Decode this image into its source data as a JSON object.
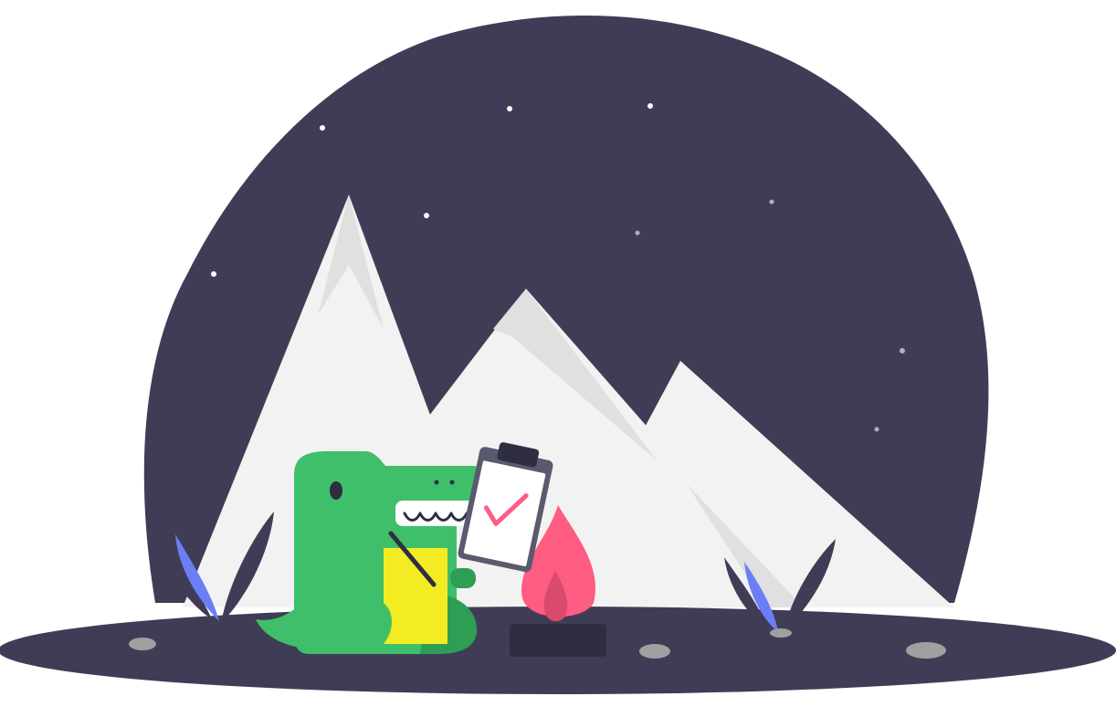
{
  "illustration": {
    "palette": {
      "background": "#ffffff",
      "night_sky": "#3f3d56",
      "ground": "#3f3d56",
      "snow": "#f2f2f2",
      "snow_shadow": "#e0e0e0",
      "star": "#ffffff",
      "dino_body": "#3fbf6a",
      "dino_dark": "#2e9e54",
      "dino_belly": "#f4ec23",
      "clipboard_frame": "#3f3d56",
      "clipboard_paper": "#ffffff",
      "checkmark": "#ff5c82",
      "flame_outer": "#ff5c82",
      "flame_inner": "#d94a6c",
      "fire_base": "#2f2e41",
      "leaf_blue": "#6c7ef5",
      "rock": "#a0a0a0"
    },
    "icons": [
      "night-sky-icon",
      "star-icon",
      "mountain-icon",
      "dinosaur-icon",
      "clipboard-icon",
      "checkmark-icon",
      "pencil-icon",
      "campfire-icon",
      "plant-icon",
      "rock-icon"
    ]
  }
}
